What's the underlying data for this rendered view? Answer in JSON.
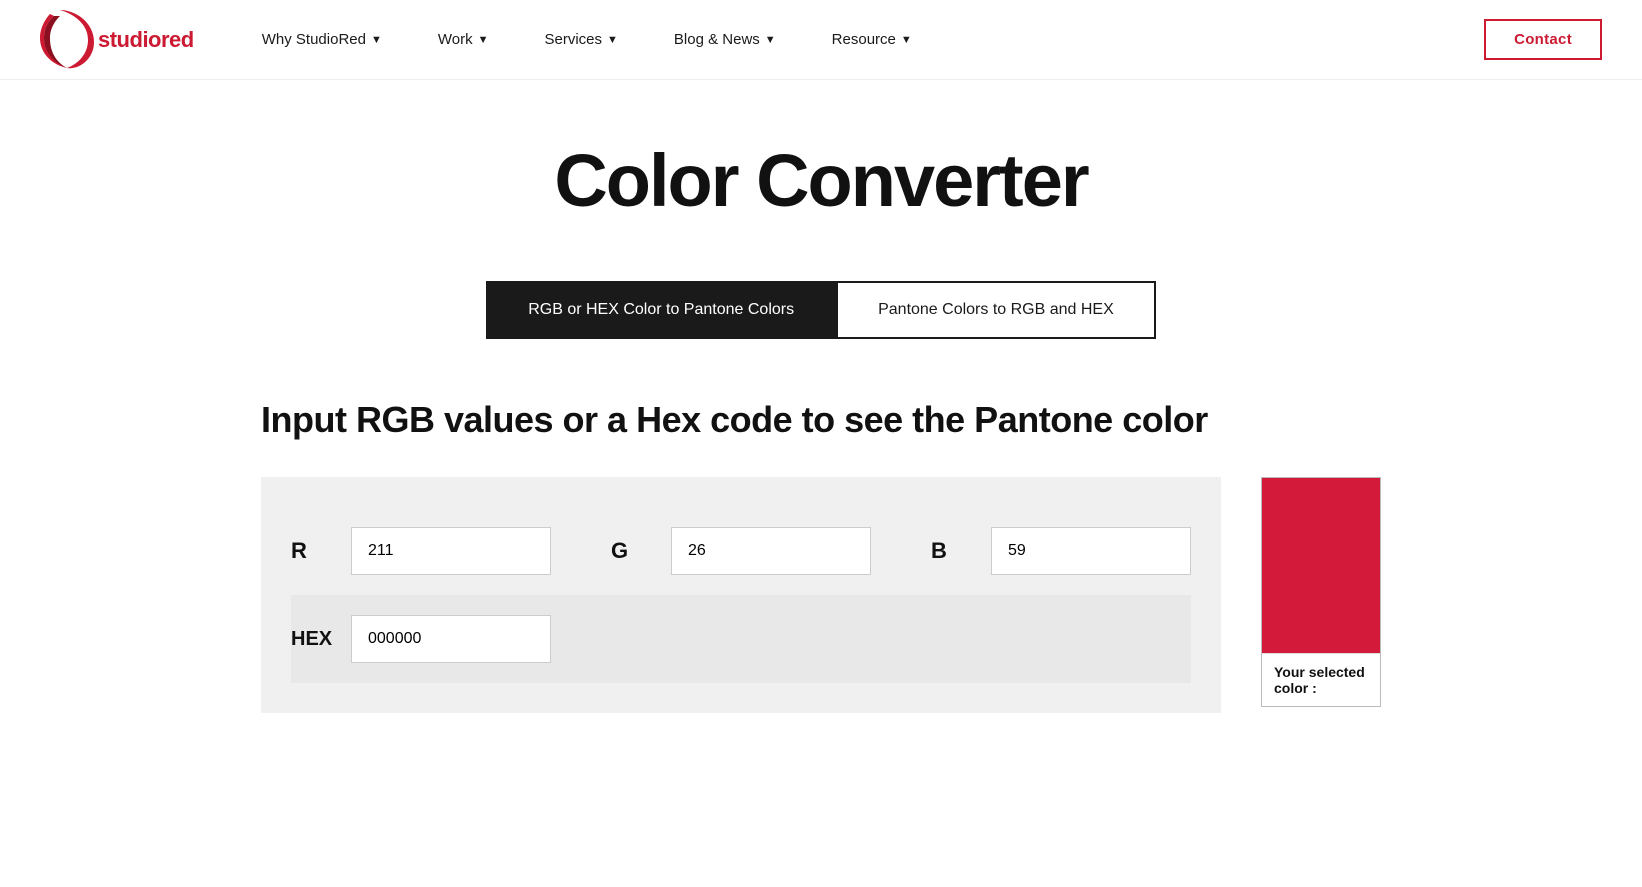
{
  "logo": {
    "text_studio": "studio",
    "text_red": "red",
    "alt": "StudioRed"
  },
  "nav": {
    "items": [
      {
        "label": "Why StudioRed",
        "has_dropdown": true
      },
      {
        "label": "Work",
        "has_dropdown": true
      },
      {
        "label": "Services",
        "has_dropdown": true
      },
      {
        "label": "Blog & News",
        "has_dropdown": true
      },
      {
        "label": "Resource",
        "has_dropdown": true
      }
    ],
    "contact_label": "Contact"
  },
  "page": {
    "title": "Color Converter",
    "tabs": [
      {
        "label": "RGB or HEX Color to Pantone Colors",
        "active": true
      },
      {
        "label": "Pantone Colors to RGB and HEX",
        "active": false
      }
    ],
    "section_heading": "Input RGB values or a Hex code to see the Pantone color",
    "fields": {
      "r_label": "R",
      "r_value": "211",
      "g_label": "G",
      "g_value": "26",
      "b_label": "B",
      "b_value": "59",
      "hex_label": "HEX",
      "hex_value": "000000",
      "hex_placeholder": "000000"
    },
    "preview": {
      "selected_color_label": "Your selected color :"
    }
  }
}
